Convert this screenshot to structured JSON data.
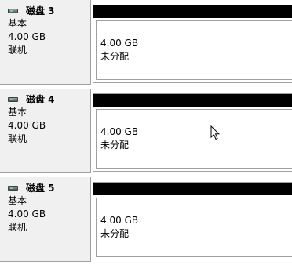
{
  "disks": [
    {
      "name": "磁盘 3",
      "type": "基本",
      "size": "4.00 GB",
      "status": "联机",
      "partition": {
        "size": "4.00 GB",
        "status": "未分配"
      }
    },
    {
      "name": "磁盘 4",
      "type": "基本",
      "size": "4.00 GB",
      "status": "联机",
      "partition": {
        "size": "4.00 GB",
        "status": "未分配"
      }
    },
    {
      "name": "磁盘 5",
      "type": "基本",
      "size": "4.00 GB",
      "status": "联机",
      "partition": {
        "size": "4.00 GB",
        "status": "未分配"
      }
    }
  ],
  "colors": {
    "label_bg": "#f0f0f0",
    "partition_header": "#000000",
    "border": "#a0a0a0"
  },
  "icons": {
    "disk": "hard-disk-icon",
    "cursor": "mouse-pointer-icon"
  }
}
